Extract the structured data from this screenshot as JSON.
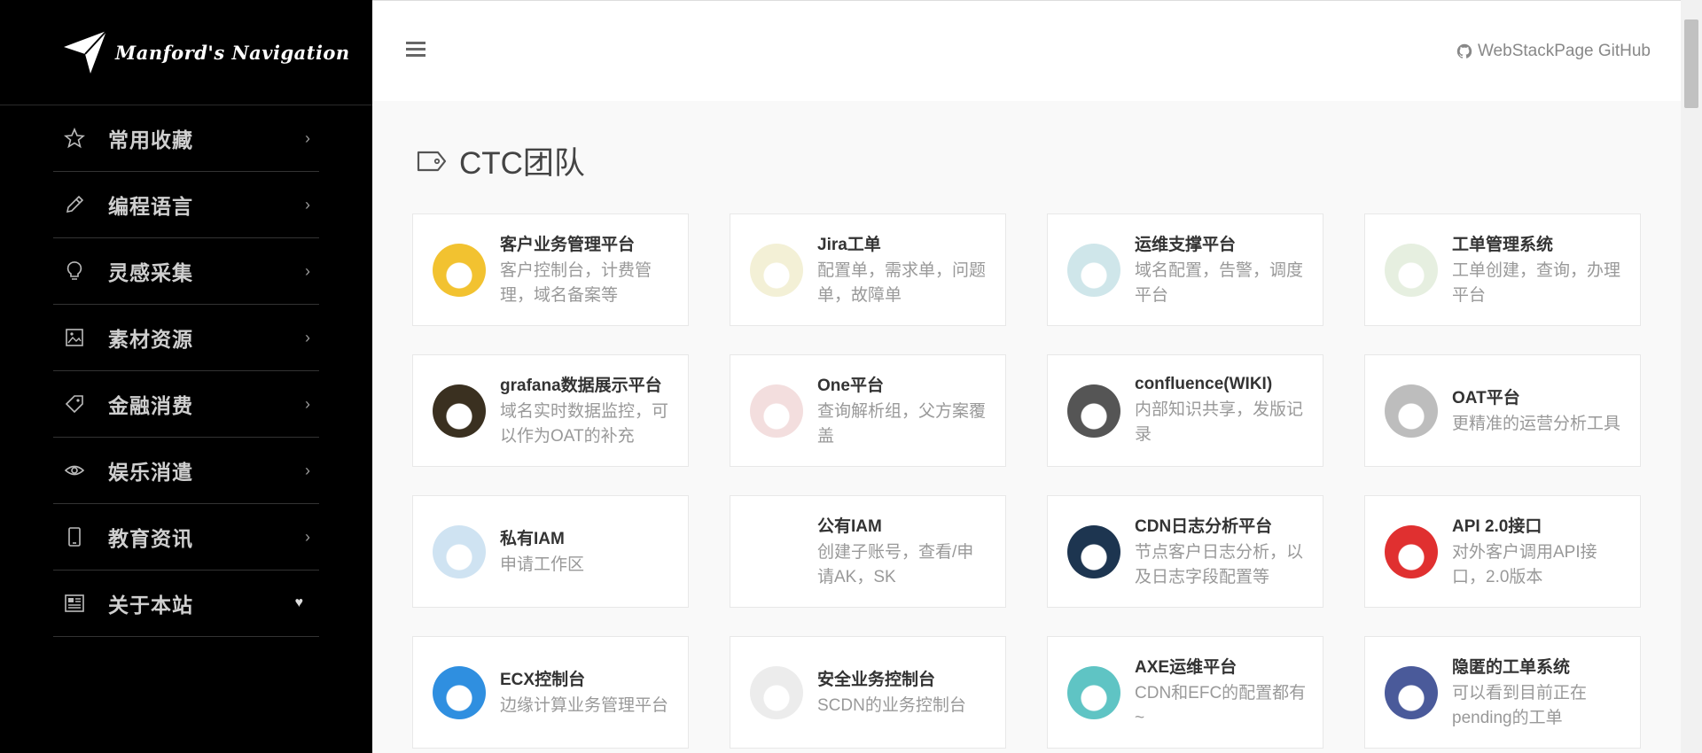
{
  "sidebar": {
    "logo_text": "Manford's Navigation",
    "items": [
      {
        "label": "常用收藏",
        "icon": "star-icon",
        "indicator": "›"
      },
      {
        "label": "编程语言",
        "icon": "pencil-icon",
        "indicator": "›"
      },
      {
        "label": "灵感采集",
        "icon": "lightbulb-icon",
        "indicator": "›"
      },
      {
        "label": "素材资源",
        "icon": "image-icon",
        "indicator": "›"
      },
      {
        "label": "金融消费",
        "icon": "tag-icon",
        "indicator": "›"
      },
      {
        "label": "娱乐消遣",
        "icon": "eye-icon",
        "indicator": "›"
      },
      {
        "label": "教育资讯",
        "icon": "mobile-icon",
        "indicator": "›"
      },
      {
        "label": "关于本站",
        "icon": "newspaper-icon",
        "indicator": "♥"
      }
    ]
  },
  "header": {
    "github_label": "WebStackPage GitHub"
  },
  "section": {
    "title": "CTC团队"
  },
  "cards": [
    {
      "title": "客户业务管理平台",
      "desc": "客户控制台，计费管理，域名备案等",
      "color": "#f2c230"
    },
    {
      "title": "Jira工单",
      "desc": "配置单，需求单，问题单，故障单",
      "color": "#f3f0d6"
    },
    {
      "title": "运维支撑平台",
      "desc": "域名配置，告警，调度平台",
      "color": "#cfe6ea"
    },
    {
      "title": "工单管理系统",
      "desc": "工单创建，查询，办理平台",
      "color": "#e6efe0"
    },
    {
      "title": "grafana数据展示平台",
      "desc": "域名实时数据监控，可以作为OAT的补充",
      "color": "#3a3020"
    },
    {
      "title": "One平台",
      "desc": "查询解析组，父方案覆盖",
      "color": "#f3dede"
    },
    {
      "title": "confluence(WIKI)",
      "desc": "内部知识共享，发版记录",
      "color": "#555555"
    },
    {
      "title": "OAT平台",
      "desc": "更精准的运营分析工具",
      "color": "#bdbdbd"
    },
    {
      "title": "私有IAM",
      "desc": "申请工作区",
      "color": "#cfe3f2"
    },
    {
      "title": "公有IAM",
      "desc": "创建子账号，查看/申请AK，SK",
      "color": "#ffffff"
    },
    {
      "title": "CDN日志分析平台",
      "desc": "节点客户日志分析，以及日志字段配置等",
      "color": "#1d3550"
    },
    {
      "title": "API 2.0接口",
      "desc": "对外客户调用API接口，2.0版本",
      "color": "#e03030"
    },
    {
      "title": "ECX控制台",
      "desc": "边缘计算业务管理平台",
      "color": "#2f8fe0"
    },
    {
      "title": "安全业务控制台",
      "desc": "SCDN的业务控制台",
      "color": "#ececec"
    },
    {
      "title": "AXE运维平台",
      "desc": "CDN和EFC的配置都有~",
      "color": "#5fc4c4"
    },
    {
      "title": "隐匿的工单系统",
      "desc": "可以看到目前正在pending的工单",
      "color": "#4a5a9a"
    }
  ]
}
